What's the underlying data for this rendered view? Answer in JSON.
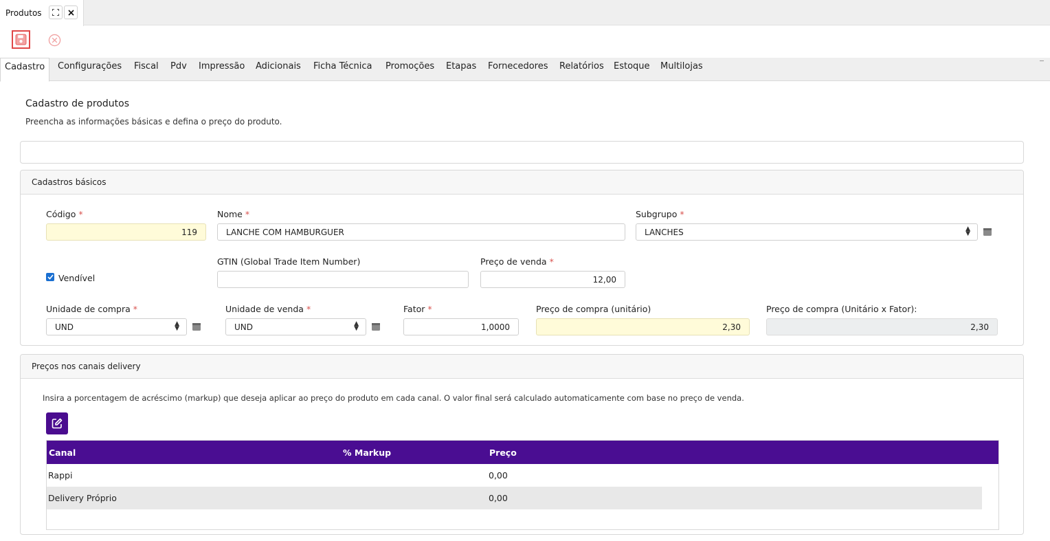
{
  "window": {
    "tab_title": "Produtos"
  },
  "toolbar": {
    "save_icon": "floppy-disk-icon",
    "cancel_icon": "circle-x-icon"
  },
  "tabs": [
    {
      "label": "Cadastro",
      "active": true
    },
    {
      "label": "Configurações"
    },
    {
      "label": "Fiscal"
    },
    {
      "label": "Pdv"
    },
    {
      "label": "Impressão"
    },
    {
      "label": "Adicionais"
    },
    {
      "label": "Ficha Técnica"
    },
    {
      "label": "Promoções"
    },
    {
      "label": "Etapas"
    },
    {
      "label": "Fornecedores"
    },
    {
      "label": "Relatórios"
    },
    {
      "label": "Estoque"
    },
    {
      "label": "Multilojas"
    }
  ],
  "page": {
    "title": "Cadastro de produtos",
    "subtitle": "Preencha as informações básicas e defina o preço do produto."
  },
  "basic": {
    "header": "Cadastros básicos",
    "codigo_label": "Código",
    "codigo_value": "119",
    "nome_label": "Nome",
    "nome_value": "LANCHE COM HAMBURGUER",
    "subgrupo_label": "Subgrupo",
    "subgrupo_value": "LANCHES",
    "vendivel_label": "Vendível",
    "vendivel_checked": true,
    "gtin_label": "GTIN (Global Trade Item Number)",
    "gtin_value": "",
    "preco_venda_label": "Preço de venda",
    "preco_venda_value": "12,00",
    "unidade_compra_label": "Unidade de compra",
    "unidade_compra_value": "UND",
    "unidade_venda_label": "Unidade de venda",
    "unidade_venda_value": "UND",
    "fator_label": "Fator",
    "fator_value": "1,0000",
    "preco_compra_label": "Preço de compra (unitário)",
    "preco_compra_value": "2,30",
    "preco_compra_fator_label": "Preço de compra (Unitário x Fator):",
    "preco_compra_fator_value": "2,30",
    "required_mark": "*"
  },
  "delivery": {
    "header": "Preços nos canais delivery",
    "description": "Insira a porcentagem de acréscimo (markup) que deseja aplicar ao preço do produto em cada canal. O valor final será calculado automaticamente com base no preço de venda.",
    "columns": [
      "Canal",
      "% Markup",
      "Preço"
    ],
    "rows": [
      {
        "canal": "Rappi",
        "markup": "",
        "preco": "0,00"
      },
      {
        "canal": "Delivery Próprio",
        "markup": "",
        "preco": "0,00"
      }
    ]
  },
  "colors": {
    "accent": "#4a0d92",
    "required": "#d9534f",
    "save_border": "#e04848",
    "yellow_field": "#fffbd9"
  }
}
